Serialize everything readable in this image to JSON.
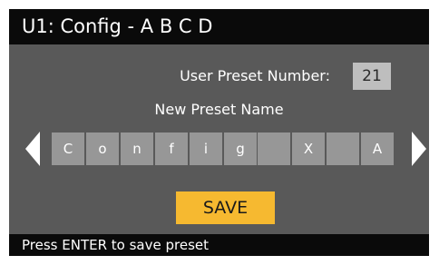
{
  "header": {
    "title": "U1: Config - A B C D"
  },
  "preset": {
    "label": "User Preset Number:",
    "value": "21"
  },
  "name_editor": {
    "label": "New Preset Name",
    "chars": [
      "C",
      "o",
      "n",
      "f",
      "i",
      "g",
      "",
      "X",
      "",
      "A"
    ]
  },
  "save_button": {
    "label": "SAVE"
  },
  "status_bar": {
    "text": "Press ENTER to save preset"
  },
  "colors": {
    "background": "#595959",
    "bars": "#0a0a0a",
    "cell": "#979797",
    "preset_box": "#bebebe",
    "accent": "#f6b930"
  },
  "icons": {
    "left": "left-arrow-icon",
    "right": "right-arrow-icon"
  }
}
